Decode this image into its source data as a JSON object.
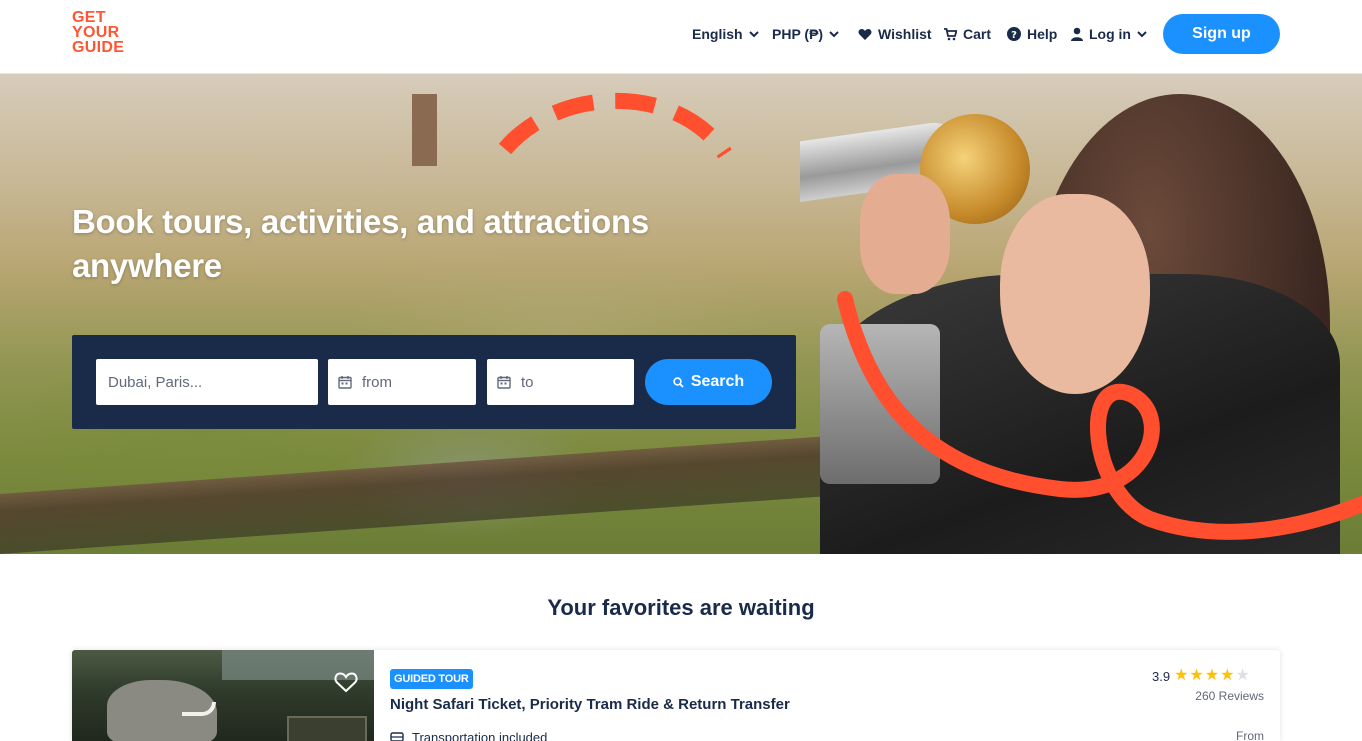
{
  "header": {
    "logo_lines": [
      "GET",
      "YOUR",
      "GUIDE"
    ],
    "language": "English",
    "currency": "PHP (₱)",
    "wishlist": "Wishlist",
    "cart": "Cart",
    "help": "Help",
    "login": "Log in",
    "signup": "Sign up"
  },
  "hero": {
    "title": "Book tours, activities, and attractions anywhere",
    "search": {
      "destination_placeholder": "Dubai, Paris...",
      "from_placeholder": "from",
      "to_placeholder": "to",
      "button": "Search"
    }
  },
  "favorites": {
    "title": "Your favorites are waiting",
    "cards": [
      {
        "badge": "GUIDED TOUR",
        "title": "Night Safari Ticket, Priority Tram Ride & Return Transfer",
        "feature": "Transportation included",
        "rating": "3.9",
        "stars_filled": 4,
        "stars_total": 5,
        "reviews": "260 Reviews",
        "price_prefix": "From"
      }
    ]
  },
  "colors": {
    "brand_orange": "#ff5533",
    "primary_blue": "#1a91ff",
    "navy": "#1a2b49",
    "star_yellow": "#ffc107",
    "star_empty": "#dcdfe4"
  },
  "icons": [
    "chevron-down-icon",
    "heart-icon",
    "cart-icon",
    "help-icon",
    "user-icon",
    "calendar-icon",
    "search-icon",
    "bus-icon",
    "star-icon"
  ]
}
